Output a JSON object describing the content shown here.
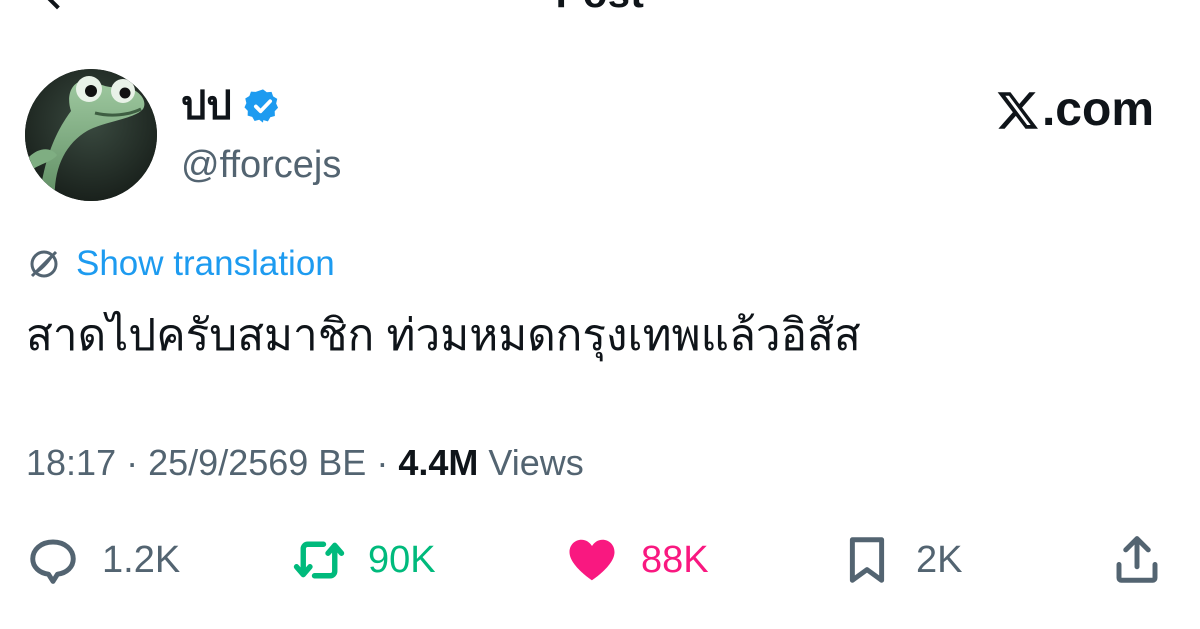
{
  "topbar": {
    "title": "Post"
  },
  "author": {
    "display_name": "ปป",
    "handle": "@fforcejs",
    "verified": true
  },
  "brand": {
    "text": ".com",
    "logo": "x-logo-icon"
  },
  "translation": {
    "label": "Show translation"
  },
  "tweet": {
    "text": "สาดไปครับสมาชิก ท่วมหมดกรุงเทพแล้วอิสัส"
  },
  "meta": {
    "time": "18:17",
    "separator": "·",
    "date": "25/9/2569 BE",
    "views_count": "4.4M",
    "views_label": "Views"
  },
  "actions": {
    "replies": "1.2K",
    "reposts": "90K",
    "likes": "88K",
    "bookmarks": "2K"
  },
  "colors": {
    "link": "#1d9bf0",
    "secondary_text": "#536471",
    "repost": "#00ba7c",
    "like": "#f91880",
    "verified": "#1d9bf0"
  }
}
